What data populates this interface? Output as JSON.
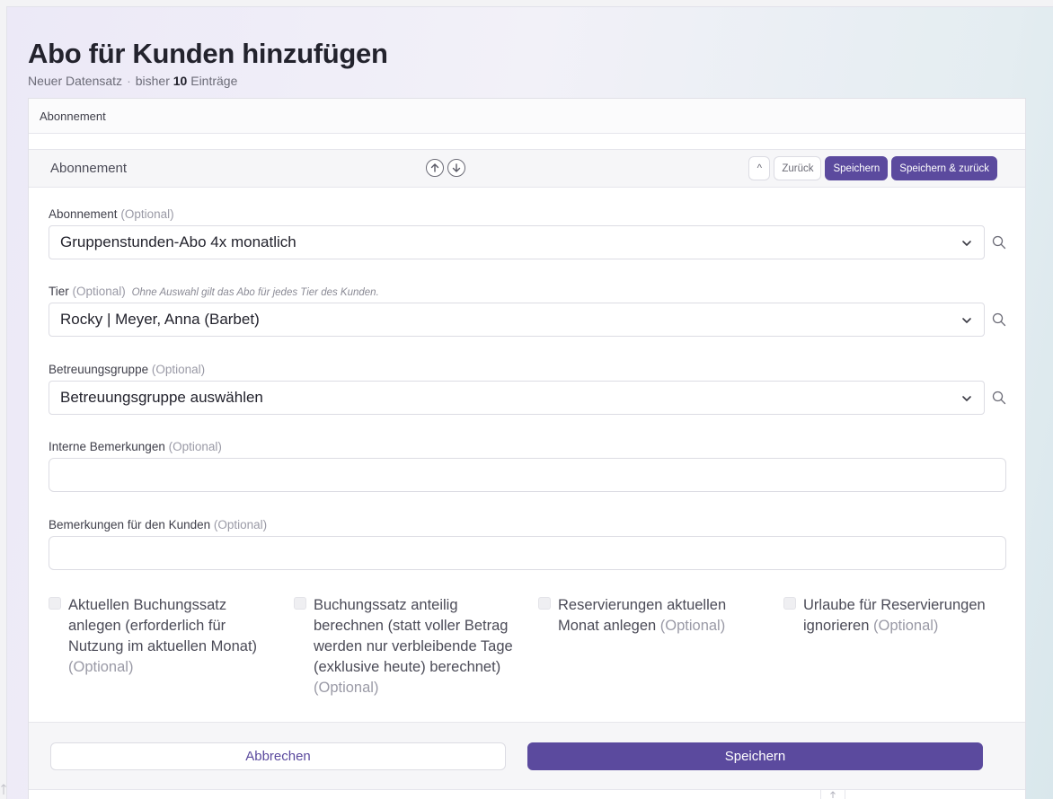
{
  "page": {
    "title": "Abo für Kunden hinzufügen",
    "subtitle_prefix": "Neuer Datensatz",
    "subtitle_dot": "·",
    "subtitle_count_prefix": "bisher",
    "subtitle_count": "10",
    "subtitle_count_suffix": "Einträge"
  },
  "tab": {
    "label": "Abonnement"
  },
  "section": {
    "title": "Abonnement",
    "actions": {
      "collapse": "^",
      "back": "Zurück",
      "save": "Speichern",
      "save_back": "Speichern & zurück"
    }
  },
  "fields": {
    "abonnement": {
      "label": "Abonnement",
      "optional": "(Optional)",
      "value": "Gruppenstunden-Abo 4x monatlich"
    },
    "tier": {
      "label": "Tier",
      "optional": "(Optional)",
      "hint": "Ohne Auswahl gilt das Abo für jedes Tier des Kunden.",
      "value": "Rocky | Meyer, Anna (Barbet)"
    },
    "betreuungsgruppe": {
      "label": "Betreuungsgruppe",
      "optional": "(Optional)",
      "value": "Betreuungsgruppe auswählen"
    },
    "interne_bemerkungen": {
      "label": "Interne Bemerkungen",
      "optional": "(Optional)",
      "value": ""
    },
    "bemerkungen_kunde": {
      "label": "Bemerkungen für den Kunden",
      "optional": "(Optional)",
      "value": ""
    }
  },
  "checkboxes": [
    {
      "label": "Aktuellen Buchungssatz anlegen (erforderlich für Nutzung im aktuellen Monat)",
      "optional": "(Optional)",
      "checked": false
    },
    {
      "label": "Buchungssatz anteilig berechnen (statt voller Betrag werden nur verbleibende Tage (exklusive heute) berechnet)",
      "optional": "(Optional)",
      "checked": false
    },
    {
      "label": "Reservierungen aktuellen Monat anlegen",
      "optional": "(Optional)",
      "checked": false
    },
    {
      "label": "Urlaube für Reservierungen ignorieren",
      "optional": "(Optional)",
      "checked": false
    }
  ],
  "footer": {
    "cancel": "Abbrechen",
    "save": "Speichern"
  },
  "colors": {
    "primary": "#5b4a9e",
    "border": "#dcdce3",
    "muted": "#9a9aa6"
  }
}
